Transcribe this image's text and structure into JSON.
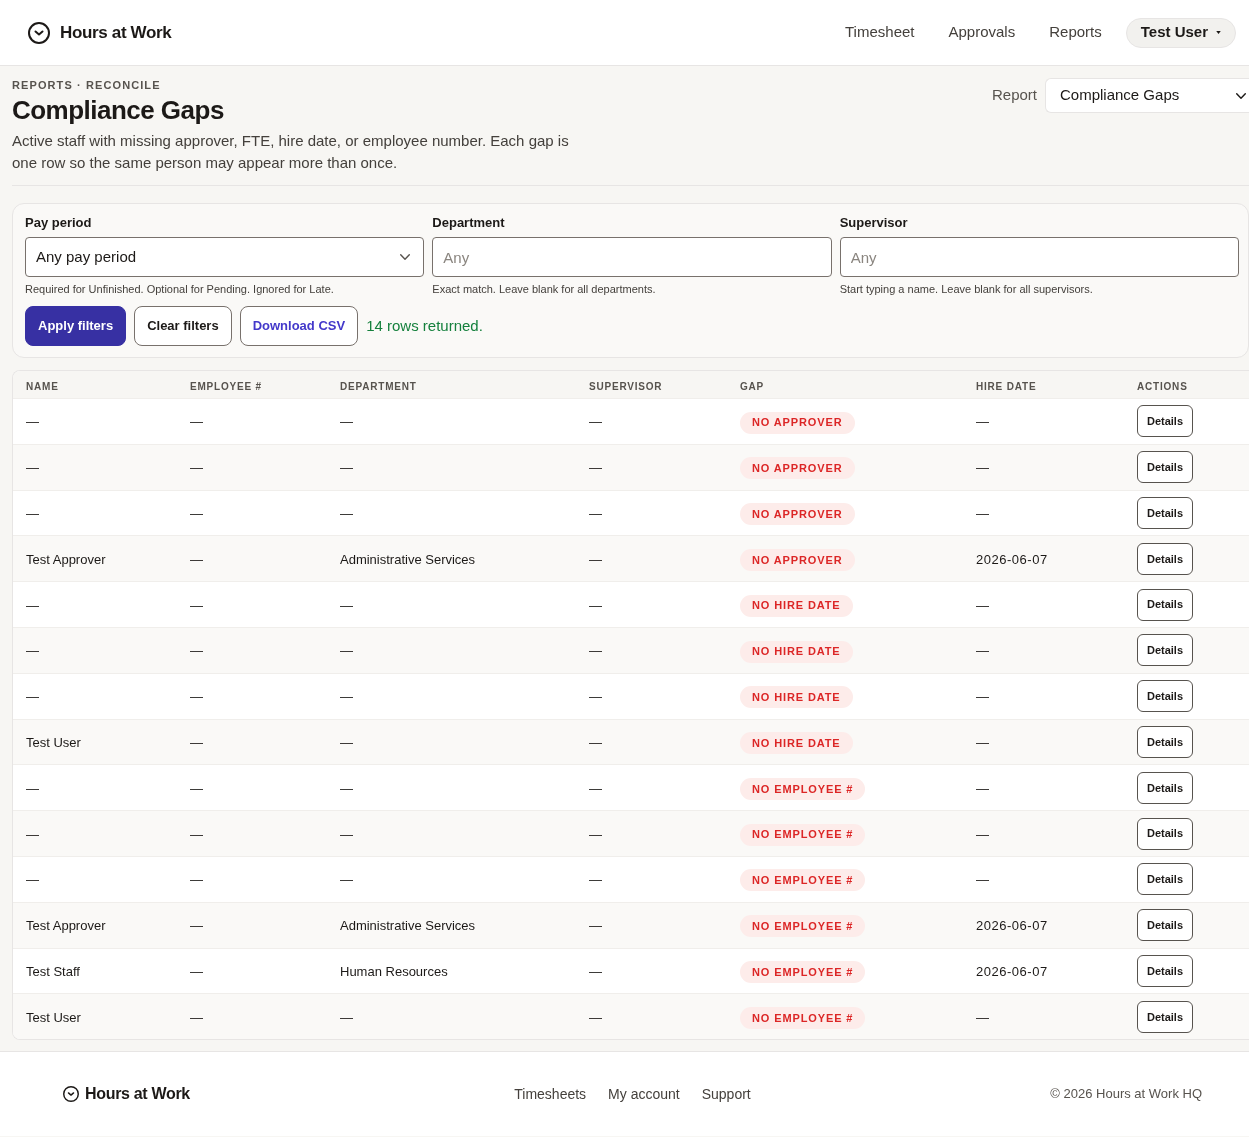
{
  "header": {
    "brand": "Hours at Work",
    "nav": [
      "Timesheet",
      "Approvals",
      "Reports"
    ],
    "user_menu": "Test User"
  },
  "page": {
    "breadcrumb": "REPORTS · RECONCILE",
    "title": "Compliance Gaps",
    "description": "Active staff with missing approver, FTE, hire date, or employee number. Each gap is one row so the same person may appear more than once.",
    "report_selector": {
      "label": "Report",
      "value": "Compliance Gaps"
    }
  },
  "filters": {
    "fields": [
      {
        "kind": "select",
        "label": "Pay period",
        "value": "Any pay period",
        "help": "Required for Unfinished. Optional for Pending. Ignored for Late."
      },
      {
        "kind": "text",
        "label": "Department",
        "placeholder": "Any",
        "help": "Exact match. Leave blank for all departments."
      },
      {
        "kind": "text",
        "label": "Supervisor",
        "placeholder": "Any",
        "help": "Start typing a name. Leave blank for all supervisors."
      }
    ],
    "buttons": [
      {
        "kind": "primary",
        "label": "Apply filters"
      },
      {
        "kind": "secondary",
        "label": "Clear filters"
      },
      {
        "kind": "link",
        "label": "Download CSV"
      }
    ],
    "result": "14 rows returned."
  },
  "table": {
    "columns": [
      "NAME",
      "EMPLOYEE #",
      "DEPARTMENT",
      "SUPERVISOR",
      "GAP",
      "HIRE DATE",
      "ACTIONS"
    ],
    "rows": [
      {
        "name": "—",
        "employee_number": "—",
        "department": "—",
        "supervisor": "—",
        "gap": "NO APPROVER",
        "hire_date": "—",
        "action": "Details"
      },
      {
        "name": "—",
        "employee_number": "—",
        "department": "—",
        "supervisor": "—",
        "gap": "NO APPROVER",
        "hire_date": "—",
        "action": "Details"
      },
      {
        "name": "—",
        "employee_number": "—",
        "department": "—",
        "supervisor": "—",
        "gap": "NO APPROVER",
        "hire_date": "—",
        "action": "Details"
      },
      {
        "name": "Test Approver",
        "employee_number": "—",
        "department": "Administrative Services",
        "supervisor": "—",
        "gap": "NO APPROVER",
        "hire_date": "2026-06-07",
        "action": "Details"
      },
      {
        "name": "—",
        "employee_number": "—",
        "department": "—",
        "supervisor": "—",
        "gap": "NO HIRE DATE",
        "hire_date": "—",
        "action": "Details"
      },
      {
        "name": "—",
        "employee_number": "—",
        "department": "—",
        "supervisor": "—",
        "gap": "NO HIRE DATE",
        "hire_date": "—",
        "action": "Details"
      },
      {
        "name": "—",
        "employee_number": "—",
        "department": "—",
        "supervisor": "—",
        "gap": "NO HIRE DATE",
        "hire_date": "—",
        "action": "Details"
      },
      {
        "name": "Test User",
        "employee_number": "—",
        "department": "—",
        "supervisor": "—",
        "gap": "NO HIRE DATE",
        "hire_date": "—",
        "action": "Details"
      },
      {
        "name": "—",
        "employee_number": "—",
        "department": "—",
        "supervisor": "—",
        "gap": "NO EMPLOYEE #",
        "hire_date": "—",
        "action": "Details"
      },
      {
        "name": "—",
        "employee_number": "—",
        "department": "—",
        "supervisor": "—",
        "gap": "NO EMPLOYEE #",
        "hire_date": "—",
        "action": "Details"
      },
      {
        "name": "—",
        "employee_number": "—",
        "department": "—",
        "supervisor": "—",
        "gap": "NO EMPLOYEE #",
        "hire_date": "—",
        "action": "Details"
      },
      {
        "name": "Test Approver",
        "employee_number": "—",
        "department": "Administrative Services",
        "supervisor": "—",
        "gap": "NO EMPLOYEE #",
        "hire_date": "2026-06-07",
        "action": "Details"
      },
      {
        "name": "Test Staff",
        "employee_number": "—",
        "department": "Human Resources",
        "supervisor": "—",
        "gap": "NO EMPLOYEE #",
        "hire_date": "2026-06-07",
        "action": "Details"
      },
      {
        "name": "Test User",
        "employee_number": "—",
        "department": "—",
        "supervisor": "—",
        "gap": "NO EMPLOYEE #",
        "hire_date": "—",
        "action": "Details"
      }
    ]
  },
  "footer": {
    "brand": "Hours at Work",
    "links": [
      "Timesheets",
      "My account",
      "Support"
    ],
    "copyright": "© 2026 Hours at Work HQ"
  }
}
